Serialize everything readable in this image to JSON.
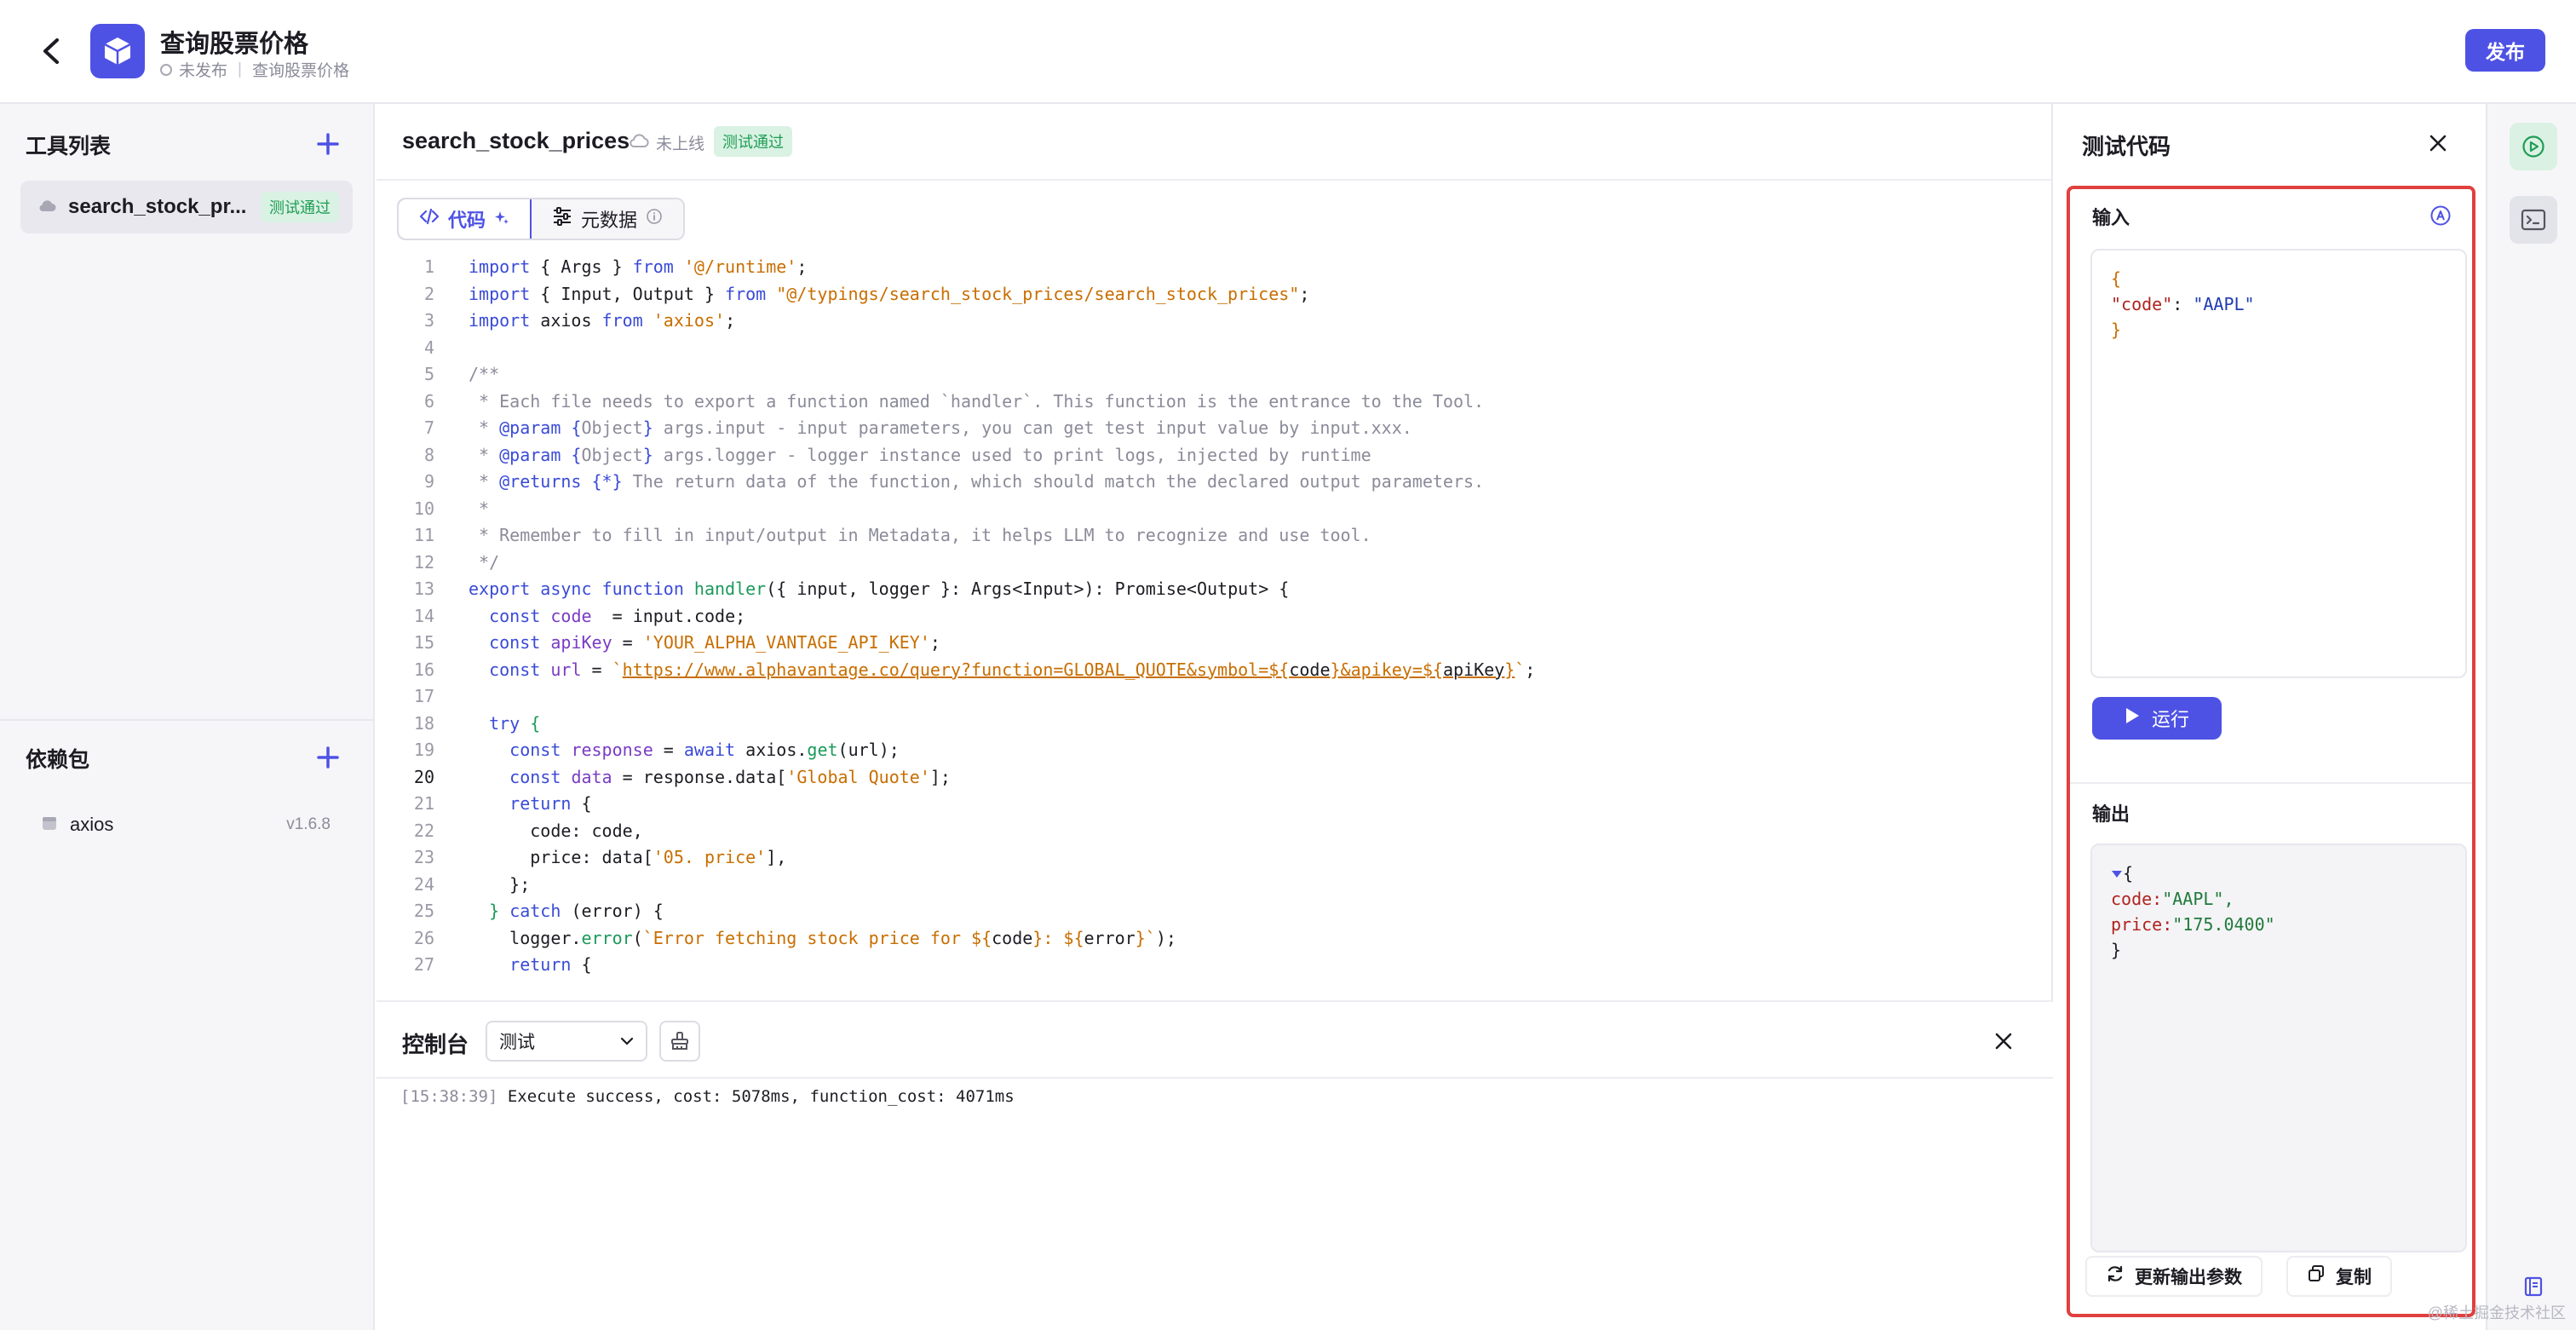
{
  "header": {
    "title": "查询股票价格",
    "status": "未发布",
    "breadcrumb": "查询股票价格",
    "publish_label": "发布"
  },
  "sidebar": {
    "tools_title": "工具列表",
    "tools": [
      {
        "name": "search_stock_pr...",
        "badge": "测试通过"
      }
    ],
    "deps_title": "依赖包",
    "deps": [
      {
        "name": "axios",
        "version": "v1.6.8"
      }
    ]
  },
  "editor": {
    "tool_name": "search_stock_prices",
    "online_status": "未上线",
    "test_badge": "测试通过",
    "tabs": [
      {
        "label": "代码"
      },
      {
        "label": "元数据"
      }
    ],
    "current_line": 20
  },
  "console": {
    "title": "控制台",
    "env_value": "测试",
    "log_time": "[15:38:39]",
    "log_message": " Execute success, cost: 5078ms, function_cost: 4071ms"
  },
  "test_panel": {
    "title": "测试代码",
    "input_label": "输入",
    "input_json_open": "{",
    "input_json_key": "\"code\"",
    "input_json_value": "\"AAPL\"",
    "input_json_close": "}",
    "run_label": "运行",
    "output_label": "输出",
    "output_code_key": "code:",
    "output_code_value": "\"AAPL\",",
    "output_price_key": "price:",
    "output_price_value": "\"175.0400\"",
    "update_label": "更新输出参数",
    "copy_label": "复制"
  },
  "watermark": "@稀土掘金技术社区",
  "colors": {
    "accent": "#4e52e4",
    "success": "#1f9d55",
    "highlight_frame": "#e0403e"
  }
}
